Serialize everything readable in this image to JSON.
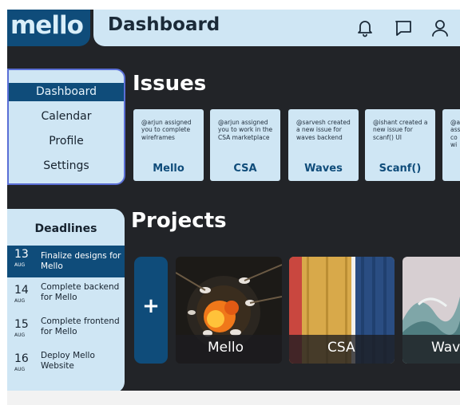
{
  "brand": {
    "name": "mello"
  },
  "header": {
    "title": "Dashboard",
    "icons": [
      "bell-icon",
      "message-icon",
      "user-icon"
    ]
  },
  "nav": {
    "items": [
      {
        "label": "Dashboard",
        "active": true
      },
      {
        "label": "Calendar",
        "active": false
      },
      {
        "label": "Profile",
        "active": false
      },
      {
        "label": "Settings",
        "active": false
      }
    ]
  },
  "deadlines": {
    "title": "Deadlines",
    "items": [
      {
        "day": "13",
        "month": "AUG",
        "text": "Finalize designs for Mello",
        "active": true
      },
      {
        "day": "14",
        "month": "AUG",
        "text": "Complete backend for Mello",
        "active": false
      },
      {
        "day": "15",
        "month": "AUG",
        "text": "Complete frontend for Mello",
        "active": false
      },
      {
        "day": "16",
        "month": "AUG",
        "text": "Deploy Mello Website",
        "active": false
      }
    ]
  },
  "issues": {
    "title": "Issues",
    "cards": [
      {
        "text": "@arjun assigned you to complete wireframes",
        "project": "Mello"
      },
      {
        "text": "@arjun assigned you to work in the CSA marketplace",
        "project": "CSA"
      },
      {
        "text": "@sarvesh created a new issue for waves backend",
        "project": "Waves"
      },
      {
        "text": "@ishant created a new issue for scanf() UI",
        "project": "Scanf()"
      },
      {
        "text": "@a ass co wi",
        "project": ""
      }
    ]
  },
  "projects": {
    "title": "Projects",
    "add_label": "+",
    "cards": [
      {
        "name": "Mello"
      },
      {
        "name": "CSA"
      },
      {
        "name": "Wav"
      }
    ]
  },
  "colors": {
    "background": "#222428",
    "panel": "#cfe6f4",
    "accent": "#0f4c7a",
    "nav_border": "#5a6fd6"
  }
}
